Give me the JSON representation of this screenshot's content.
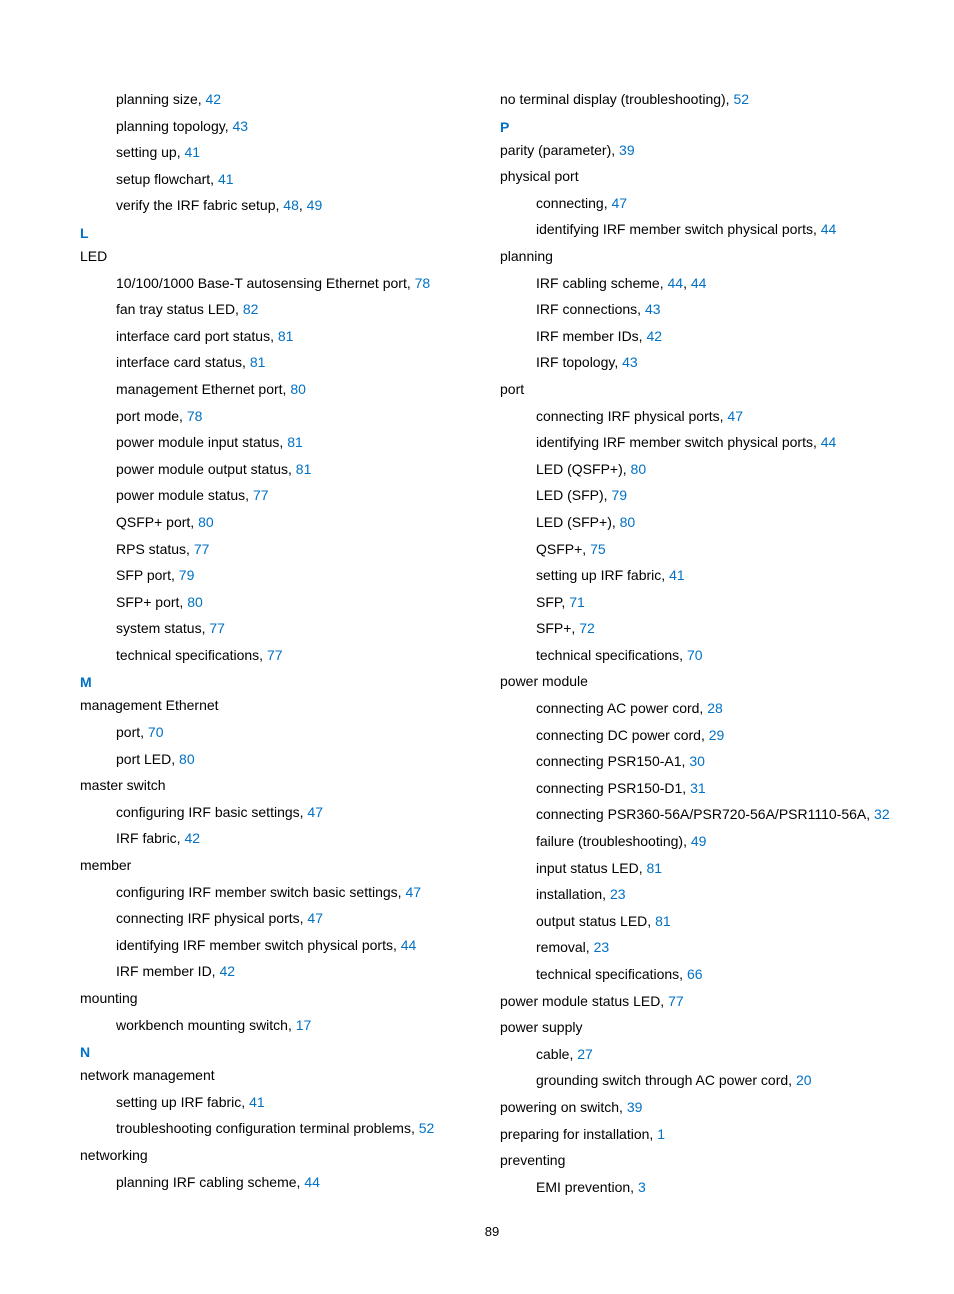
{
  "page_number": "89",
  "entries": [
    {
      "level": "sub",
      "text": "planning size, ",
      "pages": [
        "42"
      ]
    },
    {
      "level": "sub",
      "text": "planning topology, ",
      "pages": [
        "43"
      ]
    },
    {
      "level": "sub",
      "text": "setting up, ",
      "pages": [
        "41"
      ]
    },
    {
      "level": "sub",
      "text": "setup flowchart, ",
      "pages": [
        "41"
      ]
    },
    {
      "level": "sub",
      "text": "verify the IRF fabric setup, ",
      "pages": [
        "48",
        "49"
      ]
    },
    {
      "level": "letter",
      "text": "L"
    },
    {
      "level": "top",
      "text": "LED"
    },
    {
      "level": "sub",
      "text": "10/100/1000 Base-T autosensing Ethernet port, ",
      "pages": [
        "78"
      ]
    },
    {
      "level": "sub",
      "text": "fan tray status LED, ",
      "pages": [
        "82"
      ]
    },
    {
      "level": "sub",
      "text": "interface card port status, ",
      "pages": [
        "81"
      ]
    },
    {
      "level": "sub",
      "text": "interface card status, ",
      "pages": [
        "81"
      ]
    },
    {
      "level": "sub",
      "text": "management Ethernet port, ",
      "pages": [
        "80"
      ]
    },
    {
      "level": "sub",
      "text": "port mode, ",
      "pages": [
        "78"
      ]
    },
    {
      "level": "sub",
      "text": "power module input status, ",
      "pages": [
        "81"
      ]
    },
    {
      "level": "sub",
      "text": "power module output status, ",
      "pages": [
        "81"
      ]
    },
    {
      "level": "sub",
      "text": "power module status, ",
      "pages": [
        "77"
      ]
    },
    {
      "level": "sub",
      "text": "QSFP+ port, ",
      "pages": [
        "80"
      ]
    },
    {
      "level": "sub",
      "text": "RPS status, ",
      "pages": [
        "77"
      ]
    },
    {
      "level": "sub",
      "text": "SFP port, ",
      "pages": [
        "79"
      ]
    },
    {
      "level": "sub",
      "text": "SFP+ port, ",
      "pages": [
        "80"
      ]
    },
    {
      "level": "sub",
      "text": "system status, ",
      "pages": [
        "77"
      ]
    },
    {
      "level": "sub",
      "text": "technical specifications, ",
      "pages": [
        "77"
      ]
    },
    {
      "level": "letter",
      "text": "M"
    },
    {
      "level": "top",
      "text": "management Ethernet"
    },
    {
      "level": "sub",
      "text": "port, ",
      "pages": [
        "70"
      ]
    },
    {
      "level": "sub",
      "text": "port LED, ",
      "pages": [
        "80"
      ]
    },
    {
      "level": "top",
      "text": "master switch"
    },
    {
      "level": "sub",
      "text": "configuring IRF basic settings, ",
      "pages": [
        "47"
      ]
    },
    {
      "level": "sub",
      "text": "IRF fabric, ",
      "pages": [
        "42"
      ]
    },
    {
      "level": "top",
      "text": "member"
    },
    {
      "level": "sub",
      "text": "configuring IRF member switch basic settings, ",
      "pages": [
        "47"
      ]
    },
    {
      "level": "sub",
      "text": "connecting IRF physical ports, ",
      "pages": [
        "47"
      ]
    },
    {
      "level": "sub",
      "text": "identifying IRF member switch physical ports, ",
      "pages": [
        "44"
      ]
    },
    {
      "level": "sub",
      "text": "IRF member ID, ",
      "pages": [
        "42"
      ]
    },
    {
      "level": "top",
      "text": "mounting"
    },
    {
      "level": "sub",
      "text": "workbench mounting switch, ",
      "pages": [
        "17"
      ]
    },
    {
      "level": "letter",
      "text": "N"
    },
    {
      "level": "top",
      "text": "network management"
    },
    {
      "level": "sub",
      "text": "setting up IRF fabric, ",
      "pages": [
        "41"
      ]
    },
    {
      "level": "sub",
      "text": "troubleshooting configuration terminal problems, ",
      "pages": [
        "52"
      ]
    },
    {
      "level": "top",
      "text": "networking"
    },
    {
      "level": "sub",
      "text": "planning IRF cabling scheme, ",
      "pages": [
        "44"
      ]
    },
    {
      "level": "top",
      "text": "no terminal display (troubleshooting), ",
      "pages": [
        "52"
      ]
    },
    {
      "level": "letter",
      "text": "P"
    },
    {
      "level": "top",
      "text": "parity (parameter), ",
      "pages": [
        "39"
      ]
    },
    {
      "level": "top",
      "text": "physical port"
    },
    {
      "level": "sub",
      "text": "connecting, ",
      "pages": [
        "47"
      ]
    },
    {
      "level": "sub",
      "text": "identifying IRF member switch physical ports, ",
      "pages": [
        "44"
      ]
    },
    {
      "level": "top",
      "text": "planning"
    },
    {
      "level": "sub",
      "text": "IRF cabling scheme, ",
      "pages": [
        "44",
        "44"
      ]
    },
    {
      "level": "sub",
      "text": "IRF connections, ",
      "pages": [
        "43"
      ]
    },
    {
      "level": "sub",
      "text": "IRF member IDs, ",
      "pages": [
        "42"
      ]
    },
    {
      "level": "sub",
      "text": "IRF topology, ",
      "pages": [
        "43"
      ]
    },
    {
      "level": "top",
      "text": "port"
    },
    {
      "level": "sub",
      "text": "connecting IRF physical ports, ",
      "pages": [
        "47"
      ]
    },
    {
      "level": "sub",
      "text": "identifying IRF member switch physical ports, ",
      "pages": [
        "44"
      ]
    },
    {
      "level": "sub",
      "text": "LED (QSFP+), ",
      "pages": [
        "80"
      ]
    },
    {
      "level": "sub",
      "text": "LED (SFP), ",
      "pages": [
        "79"
      ]
    },
    {
      "level": "sub",
      "text": "LED (SFP+), ",
      "pages": [
        "80"
      ]
    },
    {
      "level": "sub",
      "text": "QSFP+, ",
      "pages": [
        "75"
      ]
    },
    {
      "level": "sub",
      "text": "setting up IRF fabric, ",
      "pages": [
        "41"
      ]
    },
    {
      "level": "sub",
      "text": "SFP, ",
      "pages": [
        "71"
      ]
    },
    {
      "level": "sub",
      "text": "SFP+, ",
      "pages": [
        "72"
      ]
    },
    {
      "level": "sub",
      "text": "technical specifications, ",
      "pages": [
        "70"
      ]
    },
    {
      "level": "top",
      "text": "power module"
    },
    {
      "level": "sub",
      "text": "connecting AC power cord, ",
      "pages": [
        "28"
      ]
    },
    {
      "level": "sub",
      "text": "connecting DC power cord, ",
      "pages": [
        "29"
      ]
    },
    {
      "level": "sub",
      "text": "connecting PSR150-A1, ",
      "pages": [
        "30"
      ]
    },
    {
      "level": "sub",
      "text": "connecting PSR150-D1, ",
      "pages": [
        "31"
      ]
    },
    {
      "level": "sub",
      "text": "connecting PSR360-56A/PSR720-56A/PSR1110-56A, ",
      "pages": [
        "32"
      ]
    },
    {
      "level": "sub",
      "text": "failure (troubleshooting), ",
      "pages": [
        "49"
      ]
    },
    {
      "level": "sub",
      "text": "input status LED, ",
      "pages": [
        "81"
      ]
    },
    {
      "level": "sub",
      "text": "installation, ",
      "pages": [
        "23"
      ]
    },
    {
      "level": "sub",
      "text": "output status LED, ",
      "pages": [
        "81"
      ]
    },
    {
      "level": "sub",
      "text": "removal, ",
      "pages": [
        "23"
      ]
    },
    {
      "level": "sub",
      "text": "technical specifications, ",
      "pages": [
        "66"
      ]
    },
    {
      "level": "top",
      "text": "power module status LED, ",
      "pages": [
        "77"
      ]
    },
    {
      "level": "top",
      "text": "power supply"
    },
    {
      "level": "sub",
      "text": "cable, ",
      "pages": [
        "27"
      ]
    },
    {
      "level": "sub",
      "text": "grounding switch through AC power cord, ",
      "pages": [
        "20"
      ]
    },
    {
      "level": "top",
      "text": "powering on switch, ",
      "pages": [
        "39"
      ]
    },
    {
      "level": "top",
      "text": "preparing for installation, ",
      "pages": [
        "1"
      ]
    },
    {
      "level": "top",
      "text": "preventing"
    },
    {
      "level": "sub",
      "text": "EMI prevention, ",
      "pages": [
        "3"
      ]
    }
  ]
}
